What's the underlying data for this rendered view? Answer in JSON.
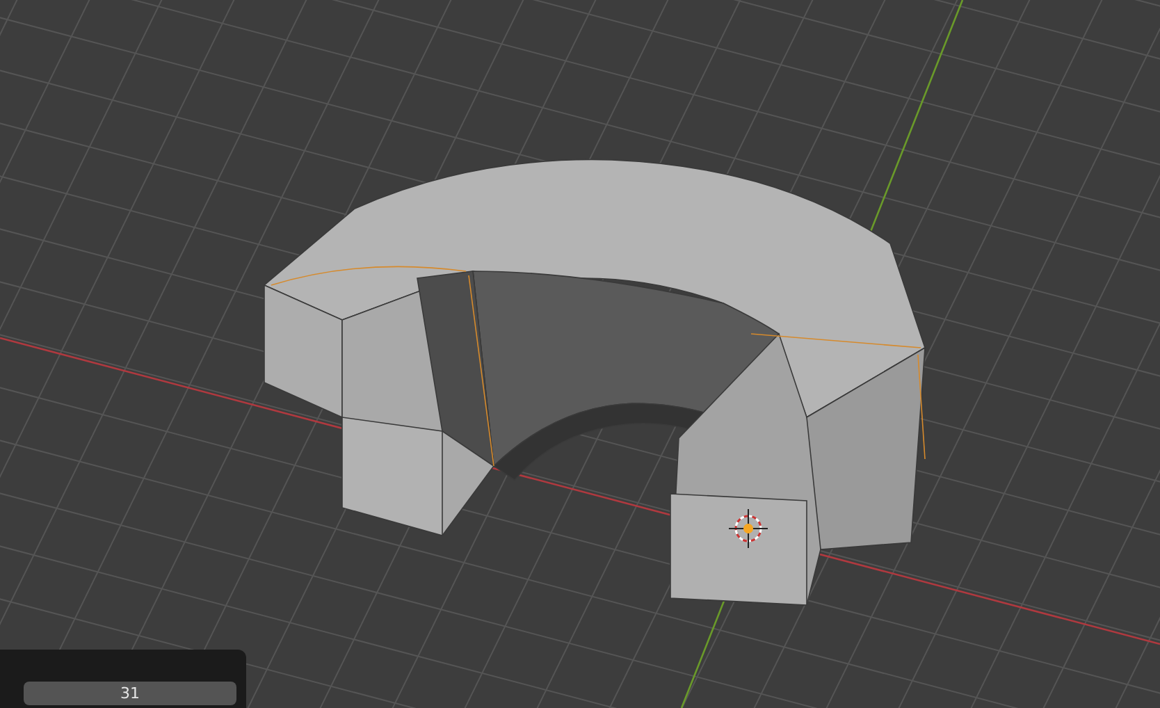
{
  "viewport": {
    "operator_panel": {
      "field_value": "31"
    }
  }
}
